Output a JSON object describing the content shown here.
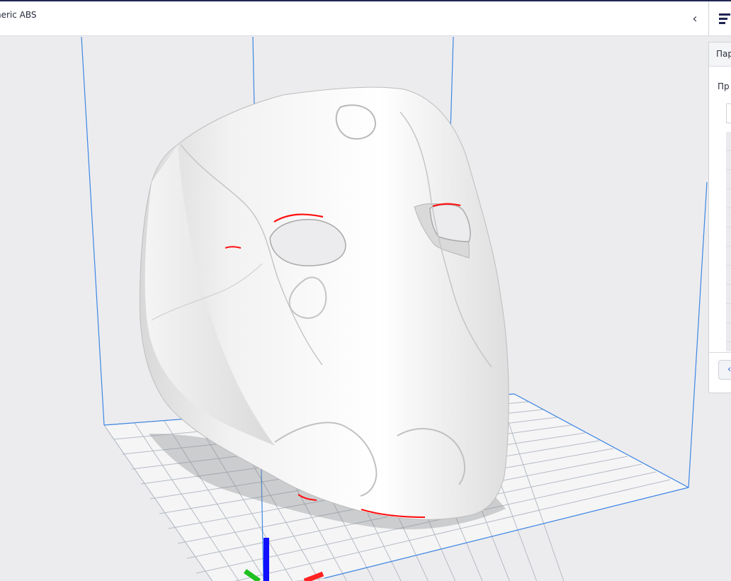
{
  "header": {
    "material_text": "neric ABS",
    "collapse_icon": "‹"
  },
  "panel": {
    "tab_label": "Пар",
    "title": "Пр",
    "back_icon": "‹"
  },
  "viewport": {
    "grid_color": "#aeb3bb",
    "build_volume_color": "#3d86e6",
    "axis_x_color": "#ff2222",
    "axis_y_color": "#20c020",
    "axis_z_color": "#1010ff",
    "overhang_color": "#ff1010"
  }
}
